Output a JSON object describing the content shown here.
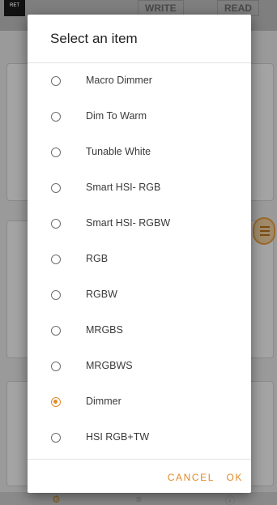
{
  "background": {
    "logo_text": "RET",
    "tabs": [
      {
        "label": "WRITE"
      },
      {
        "label": "READ"
      }
    ]
  },
  "dialog": {
    "title": "Select an item",
    "options": [
      {
        "label": "Macro Dimmer",
        "selected": false
      },
      {
        "label": "Dim To Warm",
        "selected": false
      },
      {
        "label": "Tunable White",
        "selected": false
      },
      {
        "label": "Smart HSI- RGB",
        "selected": false
      },
      {
        "label": "Smart HSI- RGBW",
        "selected": false
      },
      {
        "label": "RGB",
        "selected": false
      },
      {
        "label": "RGBW",
        "selected": false
      },
      {
        "label": "MRGBS",
        "selected": false
      },
      {
        "label": "MRGBWS",
        "selected": false
      },
      {
        "label": "Dimmer",
        "selected": true
      },
      {
        "label": "HSI RGB+TW",
        "selected": false
      }
    ],
    "cancel_label": "CANCEL",
    "ok_label": "OK"
  },
  "colors": {
    "accent": "#e08a2a",
    "scrim": "#8e8e8e"
  }
}
